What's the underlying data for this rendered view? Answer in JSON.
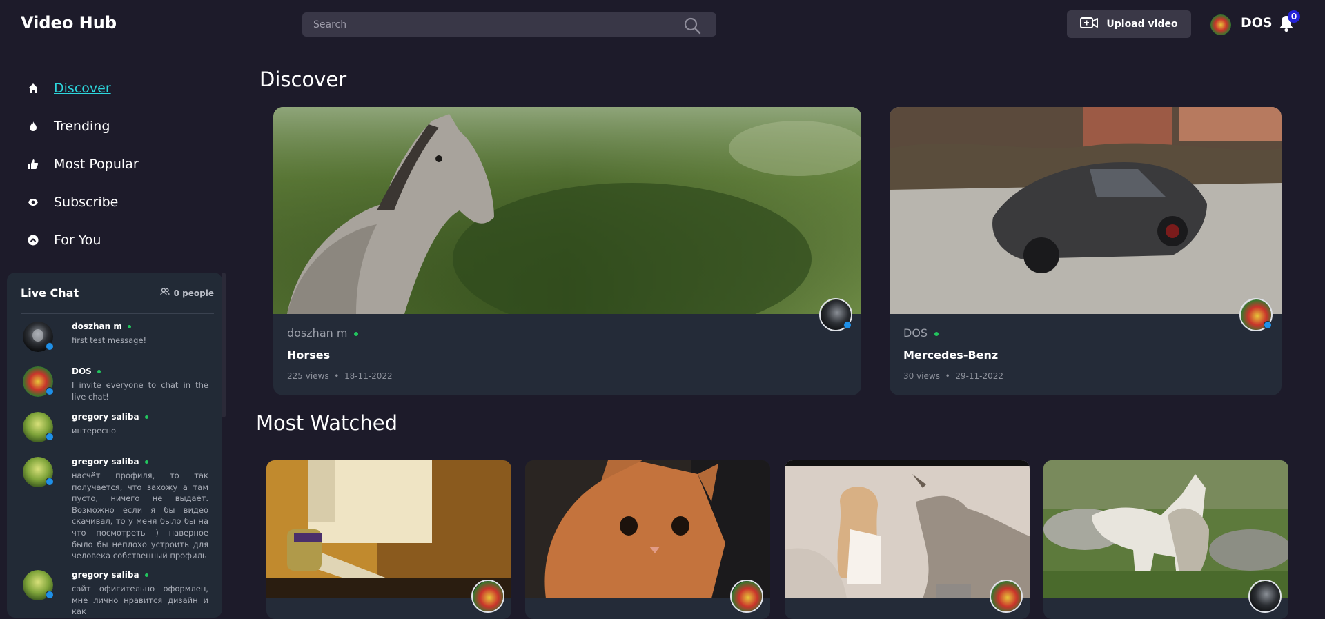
{
  "header": {
    "logo": "Video Hub",
    "search_placeholder": "Search",
    "upload_label": "Upload video",
    "username": "DOS",
    "notification_count": "0"
  },
  "nav": {
    "items": [
      {
        "label": "Discover",
        "icon": "home-icon",
        "active": true
      },
      {
        "label": "Trending",
        "icon": "fire-icon"
      },
      {
        "label": "Most Popular",
        "icon": "thumbs-up-icon"
      },
      {
        "label": "Subscribe",
        "icon": "eye-icon"
      },
      {
        "label": "For You",
        "icon": "chevron-up-circle-icon"
      }
    ]
  },
  "chat": {
    "title": "Live Chat",
    "people": "0 people",
    "messages": [
      {
        "name": "doszhan m",
        "text": "first test message!"
      },
      {
        "name": "DOS",
        "text": "I invite everyone to chat in the live chat!"
      },
      {
        "name": "gregory saliba",
        "text": "интересно"
      },
      {
        "name": "gregory saliba",
        "text": "насчёт профиля, то так получается, что захожу а там пусто, ничего не выдаёт. Возможно если я бы видео скачивал, то у меня было бы на что посмотреть ) наверное было бы неплохо устроить для человека собственный профиль"
      },
      {
        "name": "gregory saliba",
        "text": "сайт офигительно оформлен, мне лично нравится дизайн и как"
      }
    ]
  },
  "discover": {
    "heading": "Discover",
    "cards": [
      {
        "author": "doszhan m",
        "title": "Horses",
        "views": "225 views",
        "date": "18-11-2022"
      },
      {
        "author": "DOS",
        "title": "Mercedes-Benz",
        "views": "30 views",
        "date": "29-11-2022"
      }
    ]
  },
  "most_watched": {
    "heading": "Most Watched"
  },
  "colors": {
    "background": "#1d1b2a",
    "card": "#242b38",
    "accent": "#2dd7dd",
    "online": "#22c55e",
    "verified": "#1e90e8"
  }
}
